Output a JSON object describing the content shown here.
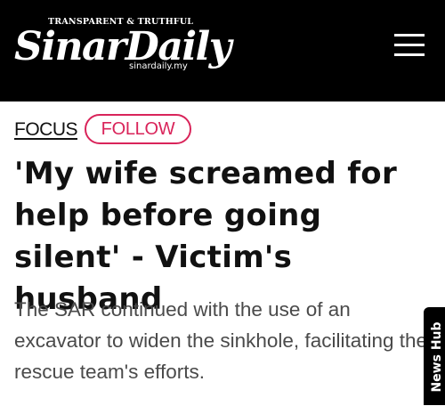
{
  "header": {
    "tagline": "TRANSPARENT & TRUTHFUL",
    "logo_text": "SinarDaily",
    "logo_domain": "sinardaily.my",
    "menu_icon": "hamburger-menu-icon",
    "background_color": "#000000"
  },
  "topic": {
    "label": "FOCUS",
    "follow_label": "FOLLOW",
    "accent_color": "#d9245a"
  },
  "article": {
    "headline": "'My wife screamed for help before going silent' - Victim's husband",
    "summary": "The SAR continued with the use of an excavator to widen the sinkhole, facilitating the rescue team's efforts."
  },
  "side_tab": {
    "label": "News Hub"
  }
}
